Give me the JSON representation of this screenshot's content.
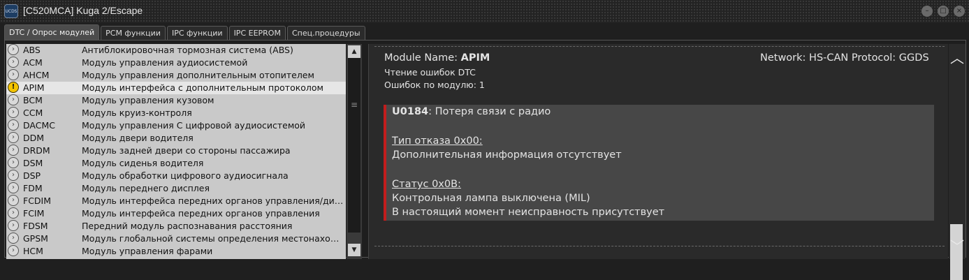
{
  "window": {
    "title": "[C520MCA] Kuga 2/Escape",
    "app_icon_text": "UCDS",
    "minimize_glyph": "–",
    "maximize_glyph": "□",
    "close_glyph": "×"
  },
  "tabs": [
    {
      "label": "DTC / Опрос модулей",
      "active": true
    },
    {
      "label": "PCM функции",
      "active": false
    },
    {
      "label": "IPC функции",
      "active": false
    },
    {
      "label": "IPC EEPROM",
      "active": false
    },
    {
      "label": "Спец.процедуры",
      "active": false
    }
  ],
  "modules": [
    {
      "code": "ABS",
      "desc": "Антиблокировочная тормозная система (ABS)",
      "icon": "chevron-right-icon"
    },
    {
      "code": "ACM",
      "desc": "Модуль управления аудиосистемой",
      "icon": "chevron-right-icon"
    },
    {
      "code": "AHCM",
      "desc": "Модуль управления дополнительным отопителем",
      "icon": "chevron-right-icon"
    },
    {
      "code": "APIM",
      "desc": "Модуль интерфейса с дополнительным протоколом",
      "icon": "warning-icon",
      "selected": true
    },
    {
      "code": "BCM",
      "desc": "Модуль управления кузовом",
      "icon": "chevron-right-icon"
    },
    {
      "code": "CCM",
      "desc": "Модуль круиз-контроля",
      "icon": "chevron-right-icon"
    },
    {
      "code": "DACMC",
      "desc": "Модуль управления С цифровой аудиосистемой",
      "icon": "chevron-right-icon"
    },
    {
      "code": "DDM",
      "desc": "Модуль двери водителя",
      "icon": "chevron-right-icon"
    },
    {
      "code": "DRDM",
      "desc": "Модуль задней двери со стороны пассажира",
      "icon": "chevron-right-icon"
    },
    {
      "code": "DSM",
      "desc": "Модуль сиденья водителя",
      "icon": "chevron-right-icon"
    },
    {
      "code": "DSP",
      "desc": "Модуль обработки цифрового аудиосигнала",
      "icon": "chevron-right-icon"
    },
    {
      "code": "FDM",
      "desc": "Модуль переднего дисплея",
      "icon": "chevron-right-icon"
    },
    {
      "code": "FCDIM",
      "desc": "Модуль интерфейса передних органов управления/дисп...",
      "icon": "chevron-right-icon"
    },
    {
      "code": "FCIM",
      "desc": "Модуль интерфейса передних органов управления",
      "icon": "chevron-right-icon"
    },
    {
      "code": "FDSM",
      "desc": "Передний модуль распознавания расстояния",
      "icon": "chevron-right-icon"
    },
    {
      "code": "GPSM",
      "desc": "Модуль глобальной системы определения местонахожд...",
      "icon": "chevron-right-icon"
    },
    {
      "code": "HCM",
      "desc": "Модуль управления фарами",
      "icon": "chevron-right-icon"
    }
  ],
  "detail": {
    "module_name_label": "Module Name:",
    "module_name_value": "APIM",
    "network": "Network: HS-CAN Protocol: GGDS",
    "reading_status": "Чтение ошибок DTC",
    "error_count": "Ошибок по модулю: 1",
    "dtc": {
      "code": "U0184",
      "title": ": Потеря связи с радио",
      "fault_type_label": "Тип отказа 0x00:",
      "fault_type_text": "Дополнительная информация отсутствует",
      "status_label": "Статус 0x0B:",
      "status_line1": "Контрольная лампа выключена (MIL)",
      "status_line2": "В настоящий момент неисправность присутствует"
    }
  },
  "colors": {
    "accent_red": "#c21d1d",
    "warning_yellow": "#f4c400"
  }
}
